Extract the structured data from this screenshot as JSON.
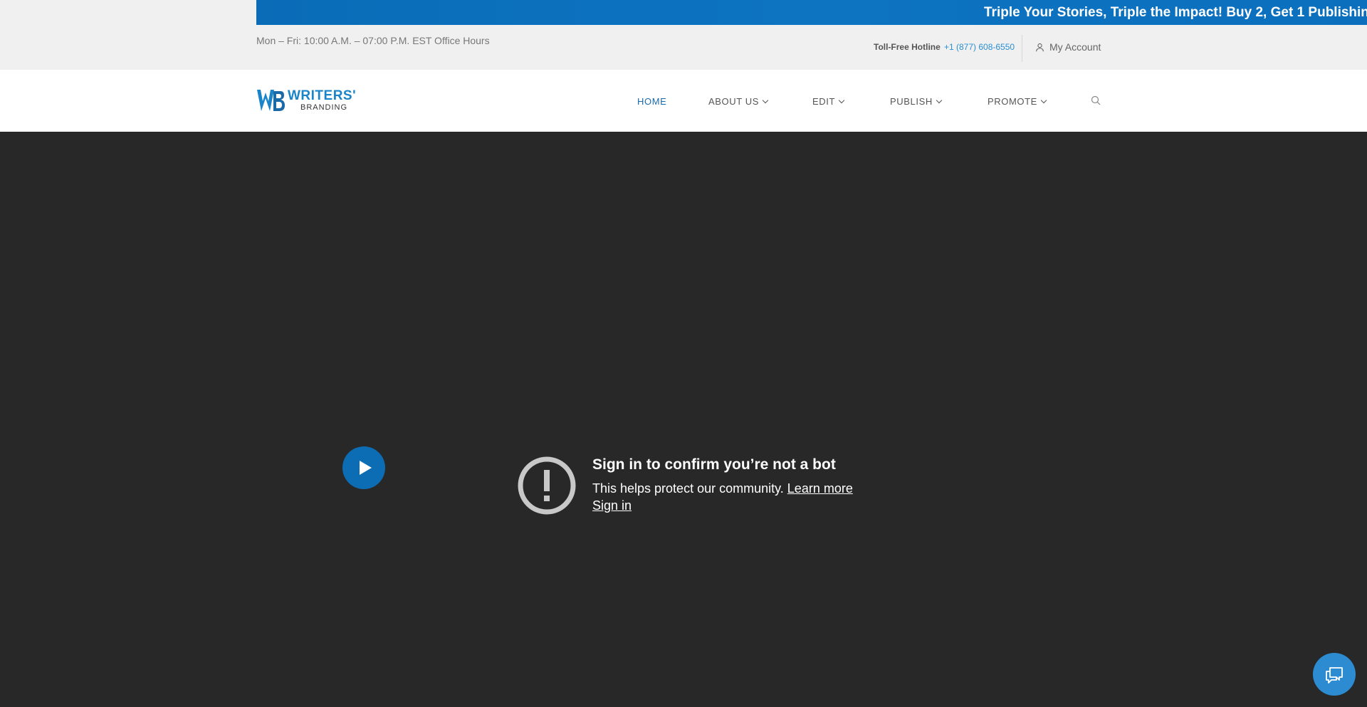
{
  "banner": {
    "text": "Triple Your Stories, Triple the Impact! Buy 2, Get 1 Publishin"
  },
  "topbar": {
    "hours": "Mon – Fri: 10:00 A.M. – 07:00 P.M. EST Office Hours",
    "hotline_label": "Toll-Free Hotline",
    "hotline_number": "+1 (877) 608-6550",
    "account_label": "My Account",
    "account_icon": "user-icon"
  },
  "logo": {
    "title": "WRITERS'",
    "subtitle": "BRANDING"
  },
  "nav": {
    "items": [
      {
        "label": "HOME",
        "active": true
      },
      {
        "label": "ABOUT US",
        "dropdown": true
      },
      {
        "label": "EDIT",
        "dropdown": true
      },
      {
        "label": "PUBLISH",
        "dropdown": true
      },
      {
        "label": "PROMOTE",
        "dropdown": true
      }
    ],
    "search_icon": "search-icon"
  },
  "video": {
    "play_icon": "play-icon",
    "alert_icon": "exclamation-circle-icon",
    "title": "Sign in to confirm you’re not a bot",
    "body": "This helps protect our community.",
    "learn_more": "Learn more",
    "sign_in": "Sign in"
  },
  "chat": {
    "icon": "chat-icon"
  },
  "colors": {
    "brand": "#0c6db5",
    "video_bg": "#282828",
    "link": "#2a8fd3"
  }
}
